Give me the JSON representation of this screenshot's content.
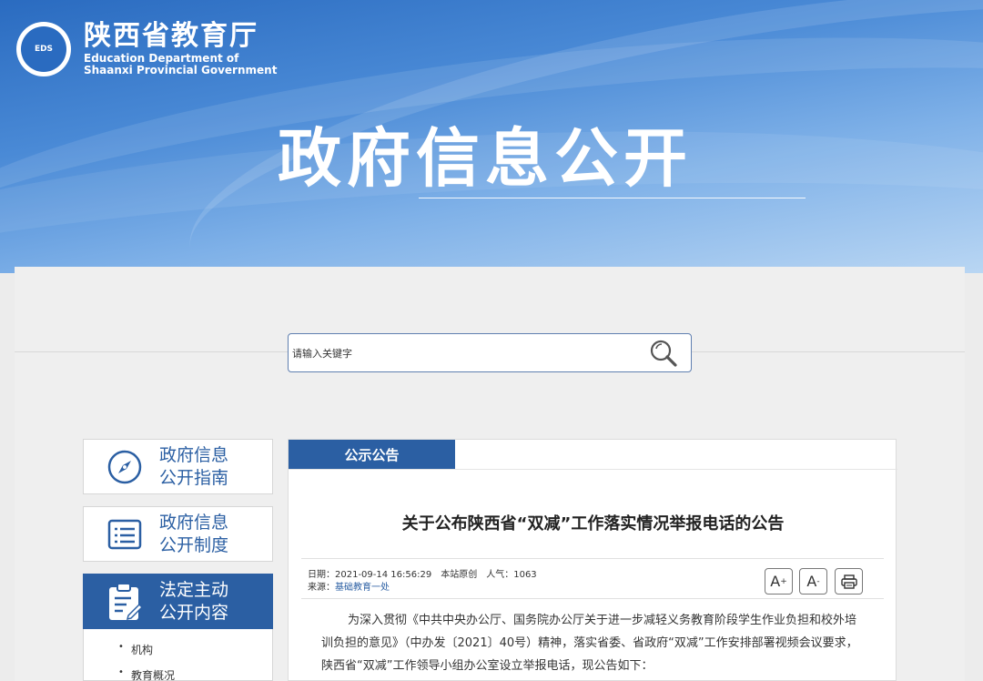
{
  "header": {
    "site_name_cn": "陕西省教育厅",
    "site_name_en_line1": "Education Department of",
    "site_name_en_line2": "Shaanxi Provincial Government",
    "logo_text": "EDS",
    "hero_title": "政府信息公开"
  },
  "search": {
    "placeholder": "请输入关键字",
    "value": ""
  },
  "sidebar": {
    "cards": [
      {
        "line1": "政府信息",
        "line2": "公开指南",
        "icon": "compass-icon",
        "active": false
      },
      {
        "line1": "政府信息",
        "line2": "公开制度",
        "icon": "list-document-icon",
        "active": false
      },
      {
        "line1": "法定主动",
        "line2": "公开内容",
        "icon": "clipboard-edit-icon",
        "active": true
      }
    ],
    "sub_items": [
      "机构",
      "教育概况"
    ]
  },
  "content": {
    "tab_label": "公示公告",
    "article_title": "关于公布陕西省“双减”工作落实情况举报电话的公告",
    "meta": {
      "date_label": "日期：",
      "date_value": "2021-09-14 16:56:29",
      "origin": "本站原创",
      "views_label": "人气：",
      "views_value": "1063",
      "source_label": "来源：",
      "source_value": "基础教育一处"
    },
    "tools": {
      "font_increase": "A",
      "font_decrease": "A",
      "print_icon": "print-icon"
    },
    "body": [
      "为深入贯彻《中共中央办公厅、国务院办公厅关于进一步减轻义务教育阶段学生作业负担和校外培",
      "训负担的意见》（中办发〔2021〕40号）精神，落实省委、省政府“双减”工作安排部署视频会议要求，",
      "陕西省“双减”工作领导小组办公室设立举报电话，现公告如下："
    ]
  },
  "colors": {
    "brand_blue": "#2b5fa3",
    "banner_blue": "#2a6bc0"
  }
}
